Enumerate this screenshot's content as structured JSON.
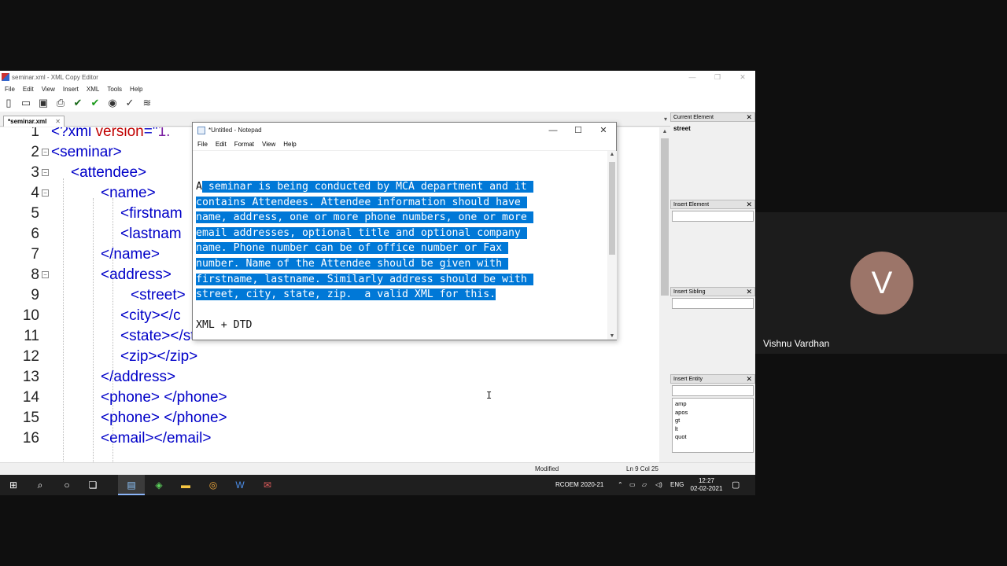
{
  "editor_window": {
    "title": "seminar.xml - XML Copy Editor",
    "menu": [
      "File",
      "Edit",
      "View",
      "Insert",
      "XML",
      "Tools",
      "Help"
    ],
    "tab": "*seminar.xml",
    "lines": [
      {
        "n": "1",
        "parts": [
          [
            "tag",
            "<?xml "
          ],
          [
            "attr",
            "version"
          ],
          [
            "tag",
            "=\""
          ],
          [
            "val",
            "1."
          ]
        ]
      },
      {
        "n": "2",
        "parts": [
          [
            "tag",
            "<seminar>"
          ]
        ]
      },
      {
        "n": "3",
        "parts": [
          [
            "tag",
            "<attendee>"
          ]
        ]
      },
      {
        "n": "4",
        "parts": [
          [
            "tag",
            "<name>"
          ]
        ]
      },
      {
        "n": "5",
        "parts": [
          [
            "tag",
            "<firstnam"
          ]
        ]
      },
      {
        "n": "6",
        "parts": [
          [
            "tag",
            "<lastnam"
          ]
        ]
      },
      {
        "n": "7",
        "parts": [
          [
            "tag",
            "</name>"
          ]
        ]
      },
      {
        "n": "8",
        "parts": [
          [
            "tag",
            "<address>"
          ]
        ]
      },
      {
        "n": "9",
        "parts": [
          [
            "tag",
            "<street>"
          ]
        ]
      },
      {
        "n": "10",
        "parts": [
          [
            "tag",
            "<city></c"
          ]
        ]
      },
      {
        "n": "11",
        "parts": [
          [
            "tag",
            "<state></state>"
          ]
        ]
      },
      {
        "n": "12",
        "parts": [
          [
            "tag",
            "<zip></zip>"
          ]
        ]
      },
      {
        "n": "13",
        "parts": [
          [
            "tag",
            "</address>"
          ]
        ]
      },
      {
        "n": "14",
        "parts": [
          [
            "tag",
            "<phone> </phone>"
          ]
        ]
      },
      {
        "n": "15",
        "parts": [
          [
            "tag",
            "<phone> </phone>"
          ]
        ]
      },
      {
        "n": "16",
        "parts": [
          [
            "tag",
            "<email></email>"
          ]
        ]
      }
    ],
    "status": {
      "modified": "Modified",
      "position": "Ln 9 Col 25"
    }
  },
  "panes": {
    "current_element": {
      "title": "Current Element",
      "value": "street"
    },
    "insert_element": {
      "title": "Insert Element"
    },
    "insert_sibling": {
      "title": "Insert Sibling"
    },
    "insert_entity": {
      "title": "Insert Entity",
      "items": [
        "amp",
        "apos",
        "gt",
        "lt",
        "quot"
      ]
    }
  },
  "notepad": {
    "title": "*Untitled - Notepad",
    "menu": [
      "File",
      "Edit",
      "Format",
      "View",
      "Help"
    ],
    "selected_lines": [
      {
        "pre": "A",
        "sel": " seminar is being conducted by MCA department and it "
      },
      {
        "pre": "",
        "sel": "contains Attendees. Attendee information should have "
      },
      {
        "pre": "",
        "sel": "name, address, one or more phone numbers, one or more "
      },
      {
        "pre": "",
        "sel": "email addresses, optional title and optional company "
      },
      {
        "pre": "",
        "sel": "name. Phone number can be of office number or Fax "
      },
      {
        "pre": "",
        "sel": "number. Name of the Attendee should be given with "
      },
      {
        "pre": "",
        "sel": "firstname, lastname. Similarly address should be with "
      },
      {
        "pre": "",
        "sel": "street, city, state, zip.  a valid XML for this."
      }
    ],
    "extra_line": "XML + DTD"
  },
  "taskbar": {
    "tray_label": "RCOEM 2020-21",
    "language": "ENG",
    "time": "12:27",
    "date": "02-02-2021"
  },
  "participant": {
    "initial": "V",
    "name": "Vishnu Vardhan"
  }
}
